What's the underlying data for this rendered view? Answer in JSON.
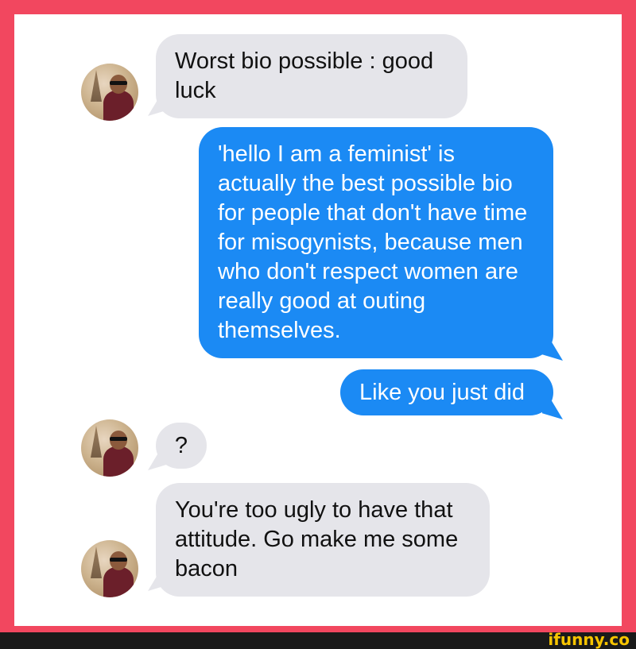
{
  "conversation": {
    "messages": [
      {
        "side": "incoming",
        "text": "Worst bio possible : good luck"
      },
      {
        "side": "outgoing",
        "text": "'hello I am a feminist' is actually the best possible bio for people that don't have time for misogynists, because men who don't respect women are really good at outing themselves."
      },
      {
        "side": "outgoing",
        "text": "Like you just did"
      },
      {
        "side": "incoming",
        "text": "?"
      },
      {
        "side": "incoming",
        "text": "You're too ugly to have that attitude. Go make me some bacon"
      }
    ]
  },
  "watermark": {
    "text": "ifunny.co"
  },
  "colors": {
    "frame": "#f2475f",
    "incoming_bubble": "#e5e5ea",
    "outgoing_bubble": "#1b8af4",
    "watermark": "#f7c400"
  }
}
